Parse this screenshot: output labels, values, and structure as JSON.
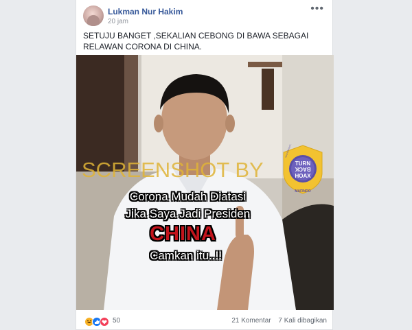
{
  "post": {
    "author": "Lukman Nur Hakim",
    "time": "20 jam",
    "more_icon": "•••",
    "text": "SETUJU BANGET ,SEKALIAN CEBONG DI BAWA SEBAGAI RELAWAN CORONA DI CHINA."
  },
  "image": {
    "watermark": "SCREENSHOT BY",
    "caption_line1": "Corona Mudah Diatasi",
    "caption_line2": "Jika Saya Jadi Presiden",
    "caption_line3": "CHINA",
    "caption_line4": "Camkan itu..!!",
    "badge": {
      "ring_text": "MASYARAKAT ANTI FITNAH INDONESIA",
      "bottom_text": "MAFINDO",
      "line1": "TURN",
      "line2": "BACK",
      "line3": "HOAX"
    }
  },
  "footer": {
    "reaction_icons": [
      "haha-icon",
      "like-icon",
      "love-icon"
    ],
    "reaction_count": "50",
    "comments": "21 Komentar",
    "shares": "7 Kali dibagikan"
  },
  "colors": {
    "link": "#365899",
    "watermark": "#e0b437",
    "caption_red": "#c3141c"
  }
}
